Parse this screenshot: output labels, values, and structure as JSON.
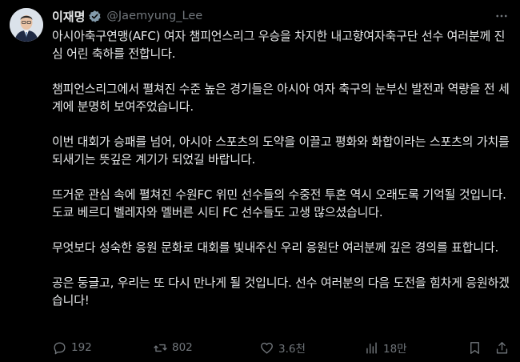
{
  "author": {
    "name": "이재명",
    "handle": "@Jaemyung_Lee"
  },
  "tweet": {
    "text": "아시아축구연맹(AFC) 여자 챔피언스리그 우승을 차지한 내고향여자축구단 선수 여러분께 진심 어린 축하를 전합니다.\n\n챔피언스리그에서 펼쳐진 수준 높은 경기들은 아시아 여자 축구의 눈부신 발전과 역량을 전 세계에 분명히 보여주었습니다.\n\n이번 대회가 승패를 넘어, 아시아 스포츠의 도약을 이끌고 평화와 화합이라는 스포츠의 가치를 되새기는 뜻깊은 계기가 되었길 바랍니다.\n\n뜨거운 관심 속에 펼쳐진 수원FC 위민 선수들의 수중전 투혼 역시 오래도록 기억될 것입니다. 도쿄 베르디 벨레자와 멜버른 시티 FC 선수들도 고생 많으셨습니다.\n\n무엇보다 성숙한 응원 문화로 대회를 빛내주신 우리 응원단 여러분께 깊은 경의를 표합니다.\n\n공은 둥글고, 우리는 또 다시 만나게 될 것입니다. 선수 여러분의 다음 도전을 힘차게 응원하겠습니다!"
  },
  "actions": {
    "replies": "192",
    "reposts": "802",
    "likes": "3.6천",
    "views": "18만"
  },
  "icons": {
    "verified": "verified-badge-icon",
    "more": "more-icon",
    "reply": "reply-icon",
    "repost": "repost-icon",
    "like": "like-icon",
    "views": "views-icon",
    "bookmark": "bookmark-icon",
    "share": "share-icon"
  },
  "colors": {
    "background": "#000000",
    "text": "#e7e9ea",
    "muted": "#71767b",
    "verified": "#829aab"
  }
}
